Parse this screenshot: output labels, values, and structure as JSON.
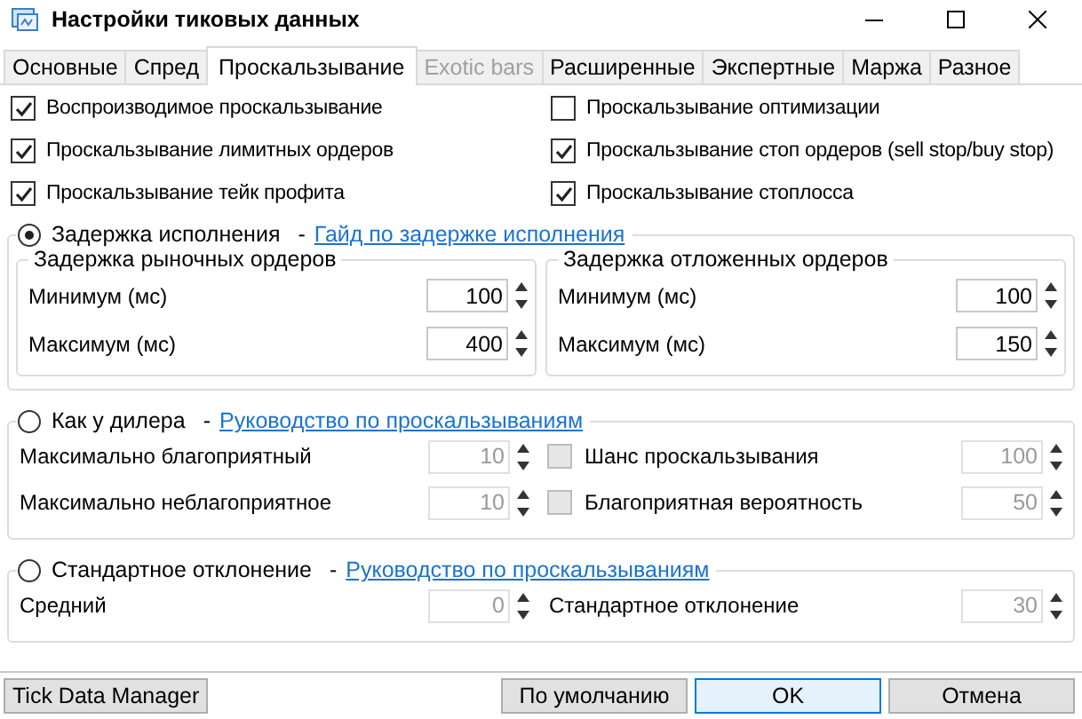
{
  "window": {
    "title": "Настройки тиковых данных"
  },
  "tabs": [
    {
      "label": "Основные",
      "selected": false,
      "disabled": false
    },
    {
      "label": "Спред",
      "selected": false,
      "disabled": false
    },
    {
      "label": "Проскальзывание",
      "selected": true,
      "disabled": false
    },
    {
      "label": "Exotic bars",
      "selected": false,
      "disabled": true
    },
    {
      "label": "Расширенные",
      "selected": false,
      "disabled": false
    },
    {
      "label": "Экспертные",
      "selected": false,
      "disabled": false
    },
    {
      "label": "Маржа",
      "selected": false,
      "disabled": false
    },
    {
      "label": "Разное",
      "selected": false,
      "disabled": false
    }
  ],
  "checkboxes": [
    {
      "label": "Воспроизводимое проскальзывание",
      "checked": true
    },
    {
      "label": "Проскальзывание оптимизации",
      "checked": false
    },
    {
      "label": "Проскальзывание лимитных ордеров",
      "checked": true
    },
    {
      "label": "Проскальзывание стоп ордеров (sell stop/buy stop)",
      "checked": true
    },
    {
      "label": "Проскальзывание тейк профита",
      "checked": true
    },
    {
      "label": "Проскальзывание стоплосса",
      "checked": true
    }
  ],
  "modes": [
    {
      "kind": "latency",
      "label": "Задержка исполнения",
      "separator": "-",
      "link": "Гайд по задержке исполнения",
      "selected": true,
      "subgroups": [
        {
          "title": "Задержка рыночных ордеров",
          "fields": [
            {
              "label": "Минимум (мс)",
              "value": "100"
            },
            {
              "label": "Максимум (мс)",
              "value": "400"
            }
          ]
        },
        {
          "title": "Задержка отложенных ордеров",
          "fields": [
            {
              "label": "Минимум (мс)",
              "value": "100"
            },
            {
              "label": "Максимум (мс)",
              "value": "150"
            }
          ]
        }
      ]
    },
    {
      "kind": "rows",
      "label": "Как у дилера",
      "separator": "-",
      "link": "Руководство по проскальзываниям",
      "selected": false,
      "rows": [
        {
          "left": {
            "label": "Максимально благоприятный",
            "value": "10"
          },
          "right": {
            "kind": "check-number",
            "label": "Шанс проскальзывания",
            "value": "100",
            "checked": false
          }
        },
        {
          "left": {
            "label": "Максимально неблагоприятное",
            "value": "10"
          },
          "right": {
            "kind": "check-number",
            "label": "Благоприятная вероятность",
            "value": "50",
            "checked": false
          }
        }
      ]
    },
    {
      "kind": "rows",
      "label": "Стандартное отклонение",
      "separator": "-",
      "link": "Руководство по проскальзываниям",
      "selected": false,
      "rows": [
        {
          "left": {
            "label": "Средний",
            "value": "0"
          },
          "right": {
            "kind": "number",
            "label": "Стандартное отклонение",
            "value": "30"
          }
        }
      ]
    }
  ],
  "buttons": {
    "left": "Tick Data Manager",
    "right": [
      {
        "label": "По умолчанию",
        "default": false
      },
      {
        "label": "OK",
        "default": true
      },
      {
        "label": "Отмена",
        "default": false
      }
    ]
  }
}
